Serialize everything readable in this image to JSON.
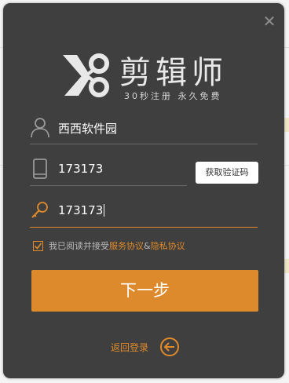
{
  "app": {
    "name": "剪辑师",
    "tagline": "30秒注册  永久免费"
  },
  "form": {
    "username_value": "西西软件园",
    "phone_value": "173173",
    "code_value": "173173",
    "get_code_label": "获取验证码"
  },
  "agreement": {
    "prefix": "我已阅读并接受",
    "service_link": "服务协议",
    "joiner": "&",
    "privacy_link": "隐私协议",
    "checked": true
  },
  "actions": {
    "next_label": "下一步",
    "back_label": "返回登录"
  },
  "icons": {
    "close": "close-icon",
    "user": "user-icon",
    "phone": "phone-icon",
    "key": "key-icon",
    "check": "check-icon",
    "back": "back-arrow-icon",
    "logo": "scissors-icon"
  },
  "colors": {
    "dialog_bg": "#3f3f3f",
    "accent": "#dd8a2c",
    "text": "#ffffff",
    "muted": "#b9b9b9"
  }
}
